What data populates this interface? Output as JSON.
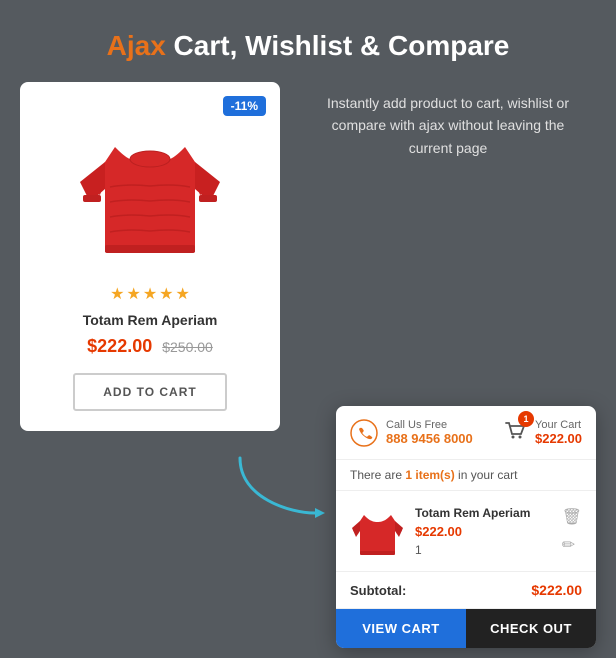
{
  "header": {
    "title_prefix": "Ajax",
    "title_suffix": " Cart, Wishlist & Compare"
  },
  "description": "Instantly add product to cart, wishlist or compare with ajax without leaving the current page",
  "product": {
    "discount": "-11%",
    "name": "Totam Rem Aperiam",
    "price_current": "$222.00",
    "price_original": "$250.00",
    "stars": 5,
    "add_to_cart_label": "ADD TO CART"
  },
  "cart_popup": {
    "call_label": "Call Us Free",
    "call_number": "888 9456 8000",
    "cart_label": "Your Cart",
    "cart_total": "$222.00",
    "cart_badge": "1",
    "items_notice_prefix": "There are ",
    "items_count": "1 item(s)",
    "items_notice_suffix": " in your cart",
    "item": {
      "name": "Totam Rem Aperiam",
      "price": "$222.00",
      "qty": "1"
    },
    "subtotal_label": "Subtotal:",
    "subtotal_amount": "$222.00",
    "view_cart_btn": "VIEW CART",
    "checkout_btn": "CHECK OUT"
  }
}
